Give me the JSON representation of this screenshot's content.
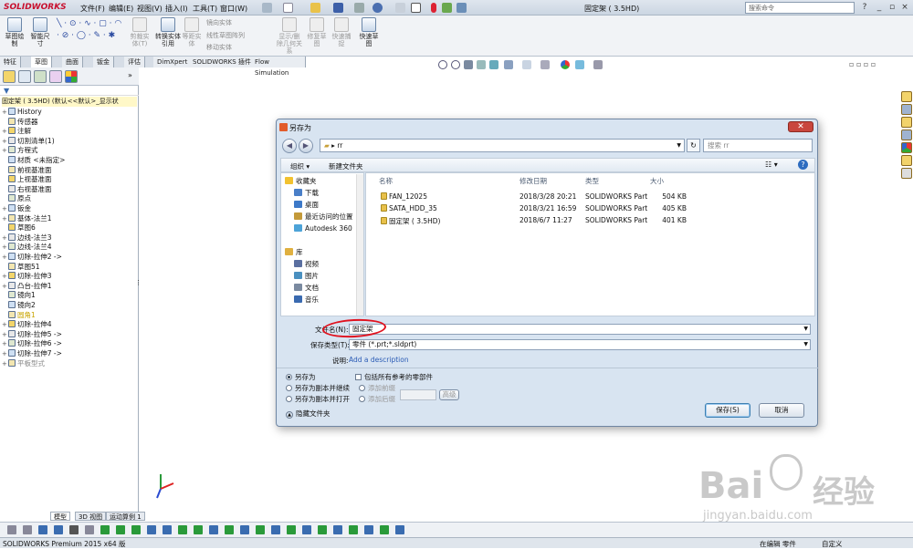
{
  "app": {
    "logo": "SOLIDWORKS",
    "doc_title": "固定架 ( 3.5HD)",
    "search_placeholder": "搜索命令"
  },
  "menu": [
    "文件(F)",
    "编辑(E)",
    "视图(V)",
    "插入(I)",
    "工具(T)",
    "窗口(W)"
  ],
  "cmd": {
    "sketch_draw": "草图绘制",
    "smart_dim": "智能尺寸",
    "trim": "剪裁实体(T)",
    "convert": "转换实体引用",
    "offset": "等距实体",
    "mirror": "镜向实体",
    "linear_pattern": "线性草图阵列",
    "move": "移动实体",
    "display_relations": "显示/删除几何关系",
    "repair": "修复草图",
    "quick_snap": "快速捕捉",
    "rapid_sketch": "快速草图"
  },
  "tabs": [
    "特征",
    "草图",
    "曲面",
    "钣金",
    "评估",
    "DimXpert",
    "SOLIDWORKS 插件",
    "Flow Simulation"
  ],
  "active_tab": "草图",
  "tree": {
    "root": "固定架 ( 3.5HD) (默认<<默认>_显示状",
    "items": [
      {
        "label": "History",
        "exp": "+",
        "hl": false,
        "gray": false
      },
      {
        "label": "传感器",
        "exp": "",
        "hl": false,
        "gray": false
      },
      {
        "label": "注解",
        "exp": "+",
        "hl": false,
        "gray": false
      },
      {
        "label": "切割清单(1)",
        "exp": "+",
        "hl": false,
        "gray": false
      },
      {
        "label": "方程式",
        "exp": "+",
        "hl": false,
        "gray": false
      },
      {
        "label": "材质 <未指定>",
        "exp": "",
        "hl": false,
        "gray": false
      },
      {
        "label": "前视基准面",
        "exp": "",
        "hl": false,
        "gray": false
      },
      {
        "label": "上视基准面",
        "exp": "",
        "hl": false,
        "gray": false
      },
      {
        "label": "右视基准面",
        "exp": "",
        "hl": false,
        "gray": false
      },
      {
        "label": "原点",
        "exp": "",
        "hl": false,
        "gray": false
      },
      {
        "label": "钣金",
        "exp": "+",
        "hl": false,
        "gray": false
      },
      {
        "label": "基体-法兰1",
        "exp": "+",
        "hl": false,
        "gray": false
      },
      {
        "label": "草图6",
        "exp": "",
        "hl": false,
        "gray": false
      },
      {
        "label": "边线-法兰3",
        "exp": "+",
        "hl": false,
        "gray": false
      },
      {
        "label": "边线-法兰4",
        "exp": "+",
        "hl": false,
        "gray": false
      },
      {
        "label": "切除-拉伸2 ->",
        "exp": "+",
        "hl": false,
        "gray": false
      },
      {
        "label": "草图51",
        "exp": "",
        "hl": false,
        "gray": false
      },
      {
        "label": "切除-拉伸3",
        "exp": "+",
        "hl": false,
        "gray": false
      },
      {
        "label": "凸台-拉伸1",
        "exp": "+",
        "hl": false,
        "gray": false
      },
      {
        "label": "镜向1",
        "exp": "",
        "hl": false,
        "gray": false
      },
      {
        "label": "镜向2",
        "exp": "",
        "hl": false,
        "gray": false
      },
      {
        "label": "圆角1",
        "exp": "",
        "hl": true,
        "gray": false
      },
      {
        "label": "切除-拉伸4",
        "exp": "+",
        "hl": false,
        "gray": false
      },
      {
        "label": "切除-拉伸5 ->",
        "exp": "+",
        "hl": false,
        "gray": false
      },
      {
        "label": "切除-拉伸6 ->",
        "exp": "+",
        "hl": false,
        "gray": false
      },
      {
        "label": "切除-拉伸7 ->",
        "exp": "+",
        "hl": false,
        "gray": false
      },
      {
        "label": "平板型式",
        "exp": "+",
        "hl": false,
        "gray": true
      }
    ]
  },
  "bottom_tabs": [
    "模型",
    "3D 视图",
    "运动算例 1"
  ],
  "status": {
    "left": "SOLIDWORKS Premium 2015 x64 版",
    "mode": "在编辑 零件",
    "custom": "自定义"
  },
  "dialog": {
    "title": "另存为",
    "close": "✕",
    "address": "rr",
    "search_placeholder": "搜索 rr",
    "organize": "组织 ▾",
    "new_folder": "新建文件夹",
    "nav": [
      {
        "label": "收藏夹",
        "group": true
      },
      {
        "label": "下载",
        "group": false
      },
      {
        "label": "桌面",
        "group": false
      },
      {
        "label": "最近访问的位置",
        "group": false
      },
      {
        "label": "Autodesk 360",
        "group": false
      },
      {
        "label": "库",
        "group": true
      },
      {
        "label": "视频",
        "group": false
      },
      {
        "label": "图片",
        "group": false
      },
      {
        "label": "文档",
        "group": false
      },
      {
        "label": "音乐",
        "group": false
      }
    ],
    "columns": [
      "名称",
      "修改日期",
      "类型",
      "大小"
    ],
    "files": [
      {
        "name": "FAN_12025",
        "date": "2018/3/28 20:21",
        "type": "SOLIDWORKS Part",
        "size": "504 KB"
      },
      {
        "name": "SATA_HDD_35",
        "date": "2018/3/21 16:59",
        "type": "SOLIDWORKS Part",
        "size": "405 KB"
      },
      {
        "name": "固定架 ( 3.5HD)",
        "date": "2018/6/7 11:27",
        "type": "SOLIDWORKS Part",
        "size": "401 KB"
      }
    ],
    "filename_label": "文件名(N):",
    "filename_value": "固定架",
    "filetype_label": "保存类型(T):",
    "filetype_value": "零件 (*.prt;*.sldprt)",
    "desc_label": "说明:",
    "desc_value": "Add a description",
    "save_as": "另存为",
    "save_copy_continue": "另存为副本并继续",
    "save_copy_open": "另存为副本并打开",
    "include_refs": "包括所有参考的零部件",
    "add_prefix": "添加前缀",
    "add_suffix": "添加后缀",
    "advanced": "高级",
    "save_btn": "保存(S)",
    "cancel_btn": "取消",
    "hide_folders": "隐藏文件夹"
  },
  "watermark": {
    "brand": "Bai",
    "cn": "经验",
    "url": "jingyan.baidu.com"
  }
}
